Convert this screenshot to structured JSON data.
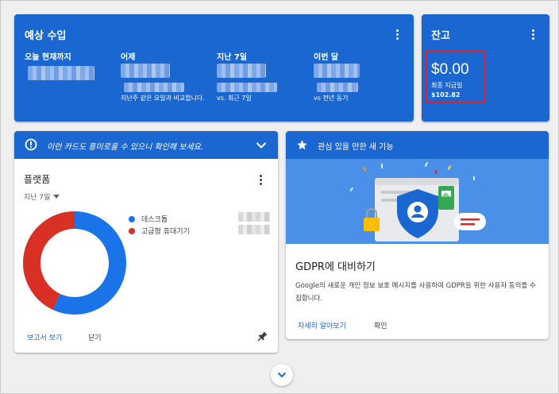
{
  "earnings": {
    "title": "예상 수입",
    "columns": [
      {
        "label": "오늘 현재까지",
        "note": ""
      },
      {
        "label": "어제",
        "note": "지난주 같은 요일과 비교합니다."
      },
      {
        "label": "지난 7일",
        "note": "vs. 최근 7일"
      },
      {
        "label": "이번 달",
        "note": "vs 전년 동기"
      }
    ]
  },
  "balance": {
    "title": "잔고",
    "amount": "$0.00",
    "last_payment_label": "최종 지급일",
    "last_payment_amount": "$102.82",
    "highlight_color": "#e0211f"
  },
  "notice": {
    "text": "이런 카드도 흥미로울 수 있으니 확인해 보세요."
  },
  "platform": {
    "title": "플랫폼",
    "range": "지난 7일",
    "legend": [
      "데스크톱",
      "고급형 휴대기기"
    ],
    "report_link": "보고서 보기",
    "close_link": "닫기"
  },
  "features": {
    "header": "관심 있을 만한 새 기능",
    "heading": "GDPR에 대비하기",
    "body": "Google의 새로운 개인 정보 보호 메시지를 사용하여 GDPR을 위한 사용자 동의를 수집합니다.",
    "learn_more": "자세히 알아보기",
    "confirm": "확인"
  },
  "chart_data": {
    "type": "pie",
    "categories": [
      "데스크톱",
      "고급형 휴대기기"
    ],
    "values": [
      57,
      43
    ],
    "colors": [
      "#1a73e8",
      "#d93025"
    ]
  },
  "colors": {
    "primary_blue": "#1a67d2",
    "illustration_blue": "#4a90e8",
    "desktop_blue": "#1a73e8",
    "mobile_red": "#d93025"
  },
  "icons": {
    "notice": "alert-circle-icon",
    "collapse": "chevron-down-icon",
    "feature": "star-icon",
    "pin": "pin-icon",
    "expand": "chevron-down-icon"
  }
}
